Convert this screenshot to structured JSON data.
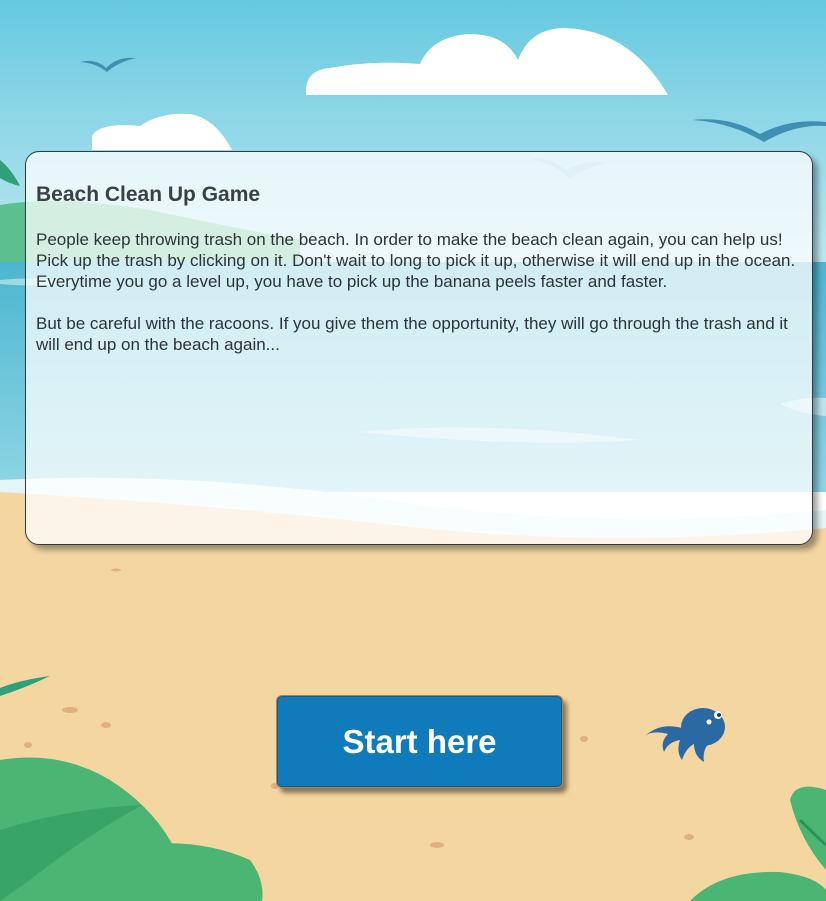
{
  "game": {
    "title": "Beach Clean Up Game",
    "paragraphs": [
      "People keep throwing trash on the beach. In order to make the beach clean again, you can help us! Pick up the trash by clicking on it. Don't wait to long to pick it up, otherwise it will end up in the ocean. Everytime you go a level up, you have to pick up the banana peels faster and faster.",
      "But be careful with the racoons. If you give them the opportunity, they will go through the trash and it will end up on the beach again..."
    ],
    "start_label": "Start here"
  },
  "colors": {
    "sky": "#6fcde2",
    "sea": "#5fbfd6",
    "sand": "#f4d6a1",
    "leaf": "#4bb574",
    "button": "#0f7bba",
    "octopus": "#2a69a3"
  },
  "icons": {
    "octopus": "octopus-icon",
    "bird": "bird-icon",
    "cloud": "cloud-icon",
    "leaf": "palm-leaf-icon"
  }
}
